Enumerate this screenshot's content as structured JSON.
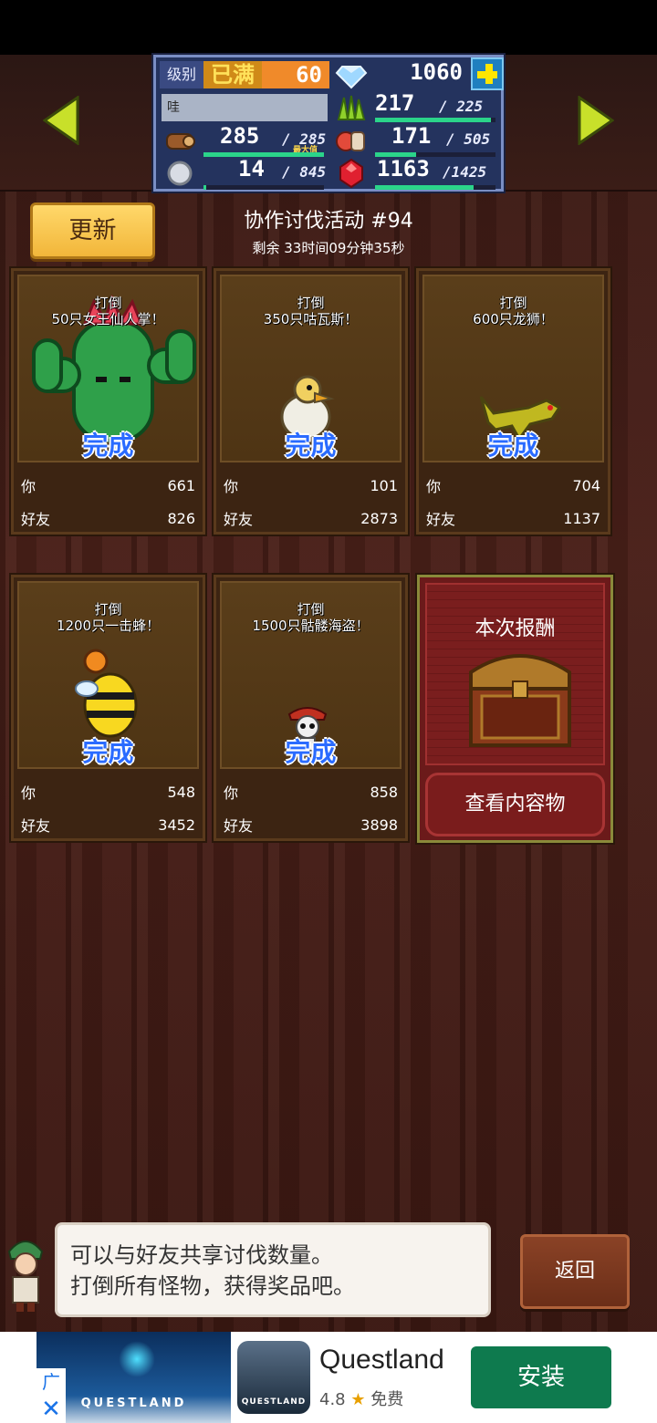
{
  "status": {
    "level_label": "级别",
    "level_max": "已满",
    "level": "60",
    "player_name": "哇",
    "gems": "1060",
    "stats": [
      {
        "icon": "grass-icon",
        "value": "217",
        "max": "/ 225",
        "fill": 0.96
      },
      {
        "icon": "wood-icon",
        "value": "285",
        "max": "/ 285",
        "note": "最大值",
        "fill": 1.0
      },
      {
        "icon": "food-icon",
        "value": "171",
        "max": "/ 505",
        "fill": 0.34
      },
      {
        "icon": "ore-icon",
        "value": "14",
        "max": "/ 845",
        "fill": 0.02
      },
      {
        "icon": "ruby-icon",
        "value": "1163",
        "max": "/1425",
        "fill": 0.82
      }
    ]
  },
  "header": {
    "refresh_label": "更新",
    "title": "协作讨伐活动 #94",
    "remaining": "剩余 33时间09分钟35秒"
  },
  "labels": {
    "you": "你",
    "friend": "好友",
    "done": "完成"
  },
  "cards": [
    {
      "line1": "打倒",
      "line2": "50只女王仙人掌！",
      "you": "661",
      "friend": "826"
    },
    {
      "line1": "打倒",
      "line2": "350只咕瓦斯！",
      "you": "101",
      "friend": "2873"
    },
    {
      "line1": "打倒",
      "line2": "600只龙狮！",
      "you": "704",
      "friend": "1137"
    },
    {
      "line1": "打倒",
      "line2": "1200只一击蜂！",
      "you": "548",
      "friend": "3452"
    },
    {
      "line1": "打倒",
      "line2": "1500只骷髅海盗！",
      "you": "858",
      "friend": "3898"
    }
  ],
  "reward": {
    "title": "本次报酬",
    "view_label": "查看内容物"
  },
  "dialog": {
    "line1": "可以与好友共享讨伐数量。",
    "line2": "打倒所有怪物，获得奖品吧。"
  },
  "back_label": "返回",
  "ad": {
    "label": "广告",
    "close": "✕",
    "image_text": "QUESTLAND",
    "icon_text": "QUESTLAND",
    "app_name": "Questland",
    "rating": "4.8",
    "star": "★",
    "price": "免费",
    "install_label": "安装"
  }
}
